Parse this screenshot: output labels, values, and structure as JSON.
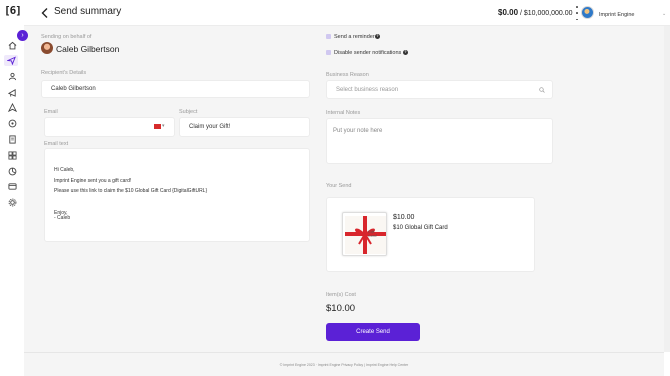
{
  "app": {
    "logo_text": "[6]"
  },
  "header": {
    "title": "Send summary",
    "balance_amount": "$0.00",
    "balance_separator": " / ",
    "balance_limit": "$10,000,000.00",
    "org_name": "Imprint Engine"
  },
  "sidebar": {
    "items": [
      {
        "icon": "home-icon"
      },
      {
        "icon": "send-icon",
        "active": true
      },
      {
        "icon": "contacts-icon"
      },
      {
        "icon": "campaigns-icon"
      },
      {
        "icon": "automations-icon"
      },
      {
        "icon": "integrations-icon"
      },
      {
        "icon": "orders-icon"
      },
      {
        "icon": "catalog-icon"
      },
      {
        "icon": "analytics-icon"
      },
      {
        "icon": "wallet-icon"
      },
      {
        "icon": "settings-icon"
      }
    ]
  },
  "left": {
    "behalf_label": "Sending on behalf of",
    "behalf_name": "Caleb Gilbertson",
    "recipient_label": "Recipient's Details",
    "recipient_value": "Caleb Gilbertson",
    "email_label": "Email",
    "email_value": "",
    "subject_label": "Subject",
    "subject_value": "Claim your Gift!",
    "email_text_label": "Email text",
    "email_lines": [
      "Hi Caleb,",
      "Imprint Engine sent you a gift card!",
      "Please use this link to claim the $10 Global Gift Card {DigitalGiftURL}",
      "Enjoy,",
      "- Caleb"
    ]
  },
  "right": {
    "reminder_label": "Send a reminder",
    "disable_notifications_label": "Disable sender notifications",
    "business_reason_label": "Business Reason",
    "business_reason_placeholder": "Select business reason",
    "internal_notes_label": "Internal Notes",
    "internal_notes_placeholder": "Put your note here",
    "your_send_label": "Your Send",
    "gift_price": "$10.00",
    "gift_name": "$10 Global Gift Card",
    "gift_thumb_text": "Gift Card",
    "cost_label": "Item(s) Cost",
    "cost_value": "$10.00",
    "create_button": "Create Send"
  },
  "footer": {
    "text": "© Imprint Engine 2023 · Imprint Engine Privacy Policy | Imprint Engine Help Center"
  },
  "colors": {
    "accent": "#5b21d6",
    "background": "#f5f5f5"
  }
}
